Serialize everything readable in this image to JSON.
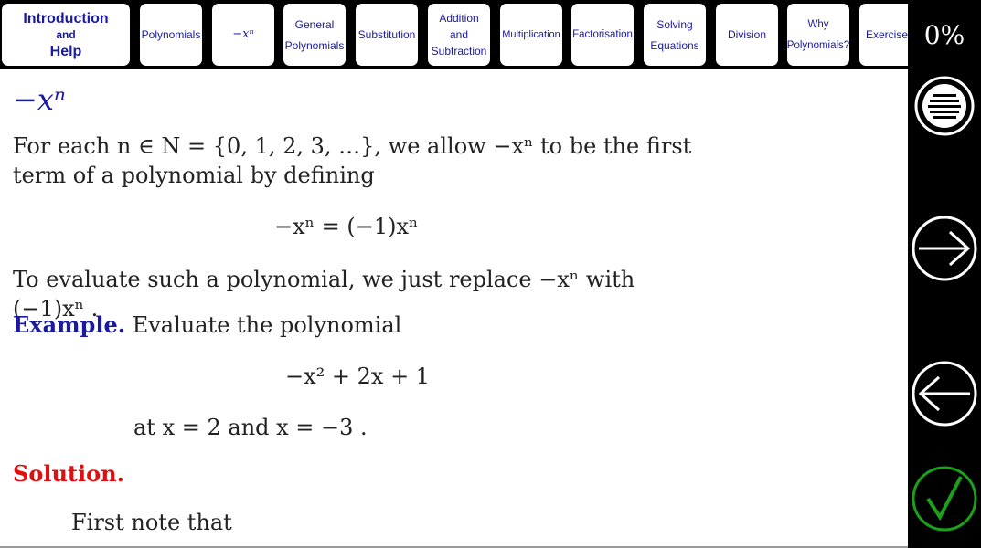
{
  "nav": {
    "intro": {
      "line1": "Introduction",
      "line2": "and",
      "line3": "Help"
    },
    "polynomials": "Polynomials",
    "minus_xn": "−xⁿ",
    "general": {
      "line1": "General",
      "line2": "Polynomials"
    },
    "substitution": "Substitution",
    "addition": {
      "line1": "Addition",
      "line2": "and",
      "line3": "Subtraction"
    },
    "multiplication": "Multiplication",
    "factorisation": "Factorisation",
    "solving": {
      "line1": "Solving",
      "line2": "Equations"
    },
    "division": "Division",
    "why": {
      "line1": "Why",
      "line2": "Polynomials?"
    },
    "exercises": "Exercises"
  },
  "progress": "0%",
  "sidebar": {
    "menu_icon": "menu-icon",
    "next_icon": "arrow-right-icon",
    "back_icon": "arrow-left-icon",
    "check_icon": "checkmark-icon",
    "check_color": "#1aa01a"
  },
  "content": {
    "heading": "−xⁿ",
    "para1_line1": "For each n ∈ N = {0, 1, 2, 3, …}, we allow −xⁿ to be the first",
    "para1_line2": "term of a polynomial by defining",
    "definition": "−xⁿ = (−1)xⁿ",
    "para2": "To evaluate such a polynomial, we just replace −xⁿ with (−1)xⁿ .",
    "example_label": "Example.",
    "example_text": "Evaluate the polynomial",
    "polynomial": "−x² + 2x + 1",
    "at_values": "at x = 2 and x = −3 .",
    "solution_label": "Solution.",
    "first_note": "First note that"
  }
}
